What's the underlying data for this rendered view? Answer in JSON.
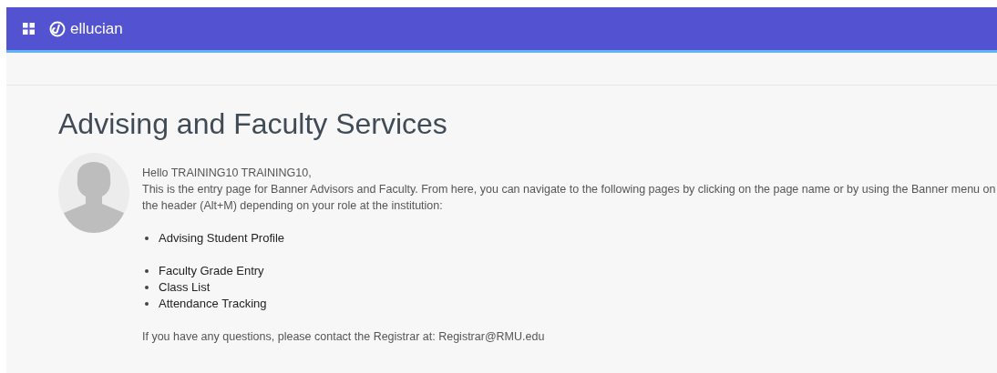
{
  "header": {
    "brand": "ellucian"
  },
  "page_title": "Advising and Faculty Services",
  "greeting": "Hello TRAINING10 TRAINING10,",
  "intro": "This is the entry page for Banner Advisors and Faculty. From here, you can navigate to the following pages by clicking on the page name or by using the Banner menu on the header (Alt+M) depending on your role at the institution:",
  "link_groups": [
    {
      "items": [
        "Advising Student Profile"
      ]
    },
    {
      "items": [
        "Faculty Grade Entry",
        "Class List",
        "Attendance Tracking"
      ]
    }
  ],
  "contact": "If you have any questions, please contact the Registrar at: Registrar@RMU.edu"
}
